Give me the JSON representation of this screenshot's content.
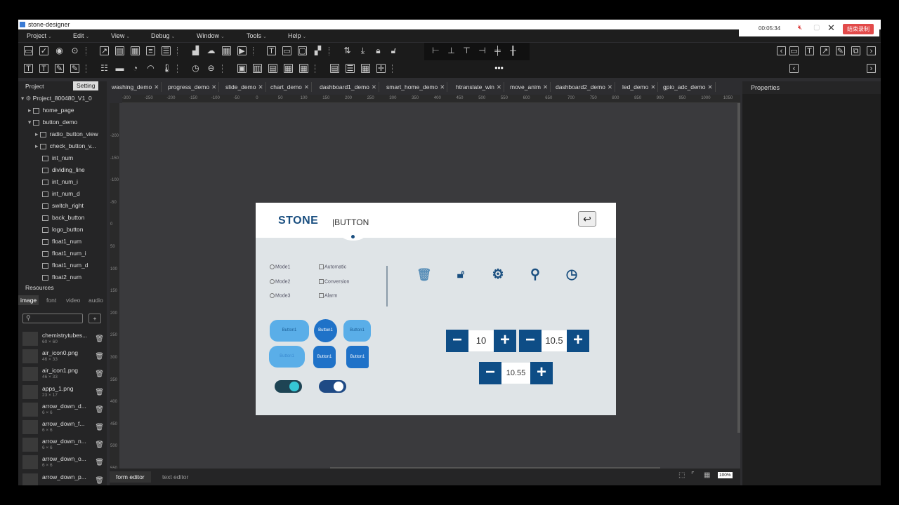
{
  "window": {
    "title": "stone-designer"
  },
  "menu": [
    "Project",
    "Edit",
    "View",
    "Debug",
    "Window",
    "Tools",
    "Help"
  ],
  "recorder": {
    "time": "00:05:34",
    "stop_label": "结束录制"
  },
  "left_panel": {
    "tabs": {
      "project": "Project",
      "setting": "Setting"
    },
    "project_name": "Project_800480_V1_0",
    "pages": [
      "home_page",
      "button_demo"
    ],
    "widgets": [
      "radio_button_view",
      "check_button_v...",
      "int_num",
      "dividing_line",
      "int_num_i",
      "int_num_d",
      "switch_right",
      "back_button",
      "logo_button",
      "float1_num",
      "float1_num_i",
      "float1_num_d",
      "float2_num"
    ],
    "resources_label": "Resources",
    "resource_tabs": [
      "image",
      "font",
      "video",
      "audio"
    ],
    "images": [
      {
        "name": "chemistrytubes...",
        "size": "60 × 60"
      },
      {
        "name": "air_icon0.png",
        "size": "46 × 33"
      },
      {
        "name": "air_icon1.png",
        "size": "46 × 33"
      },
      {
        "name": "apps_1.png",
        "size": "23 × 17"
      },
      {
        "name": "arrow_down_d...",
        "size": "6 × 6"
      },
      {
        "name": "arrow_down_f...",
        "size": "6 × 6"
      },
      {
        "name": "arrow_down_n...",
        "size": "6 × 6"
      },
      {
        "name": "arrow_down_o...",
        "size": "6 × 6"
      },
      {
        "name": "arrow_down_p...",
        "size": ""
      }
    ]
  },
  "tabs": [
    "washing_demo",
    "progress_demo",
    "slide_demo",
    "chart_demo",
    "dashboard1_demo",
    "smart_home_demo",
    "htranslate_win",
    "move_anim",
    "dashboard2_demo",
    "led_demo",
    "gpio_adc_demo"
  ],
  "ruler_top": [
    "-300",
    "-250",
    "-200",
    "-150",
    "-100",
    "-50",
    "0",
    "50",
    "100",
    "150",
    "200",
    "250",
    "300",
    "350",
    "400",
    "450",
    "500",
    "550",
    "600",
    "650",
    "700",
    "750",
    "800",
    "850",
    "900",
    "950",
    "1000",
    "1050"
  ],
  "ruler_left": [
    "-200",
    "-150",
    "-100",
    "-50",
    "0",
    "50",
    "100",
    "150",
    "200",
    "250",
    "300",
    "350",
    "400",
    "450",
    "500",
    "550"
  ],
  "properties_label": "Properties",
  "bottom": {
    "form_editor": "form editor",
    "text_editor": "text editor",
    "zoom": "100%"
  },
  "screen": {
    "logo": "STONE",
    "title": "|BUTTON",
    "radios": [
      "Mode1",
      "Mode2",
      "Mode3"
    ],
    "checks": [
      "Automatic",
      "Conversion",
      "Alarm"
    ],
    "button_label": "Button1",
    "stepper1": {
      "minus": "−",
      "value": "10",
      "plus": "+"
    },
    "stepper2": {
      "minus": "−",
      "value": "10.5",
      "plus": "+"
    },
    "stepper3": {
      "minus": "−",
      "value": "10.55",
      "plus": "+"
    },
    "colors": {
      "logo": "#1a4f80",
      "stepper": "#0e4d86",
      "pill_light": "#5aaee8",
      "pill_dark": "#1f72c8",
      "toggle_on": "#36c6d6"
    }
  }
}
